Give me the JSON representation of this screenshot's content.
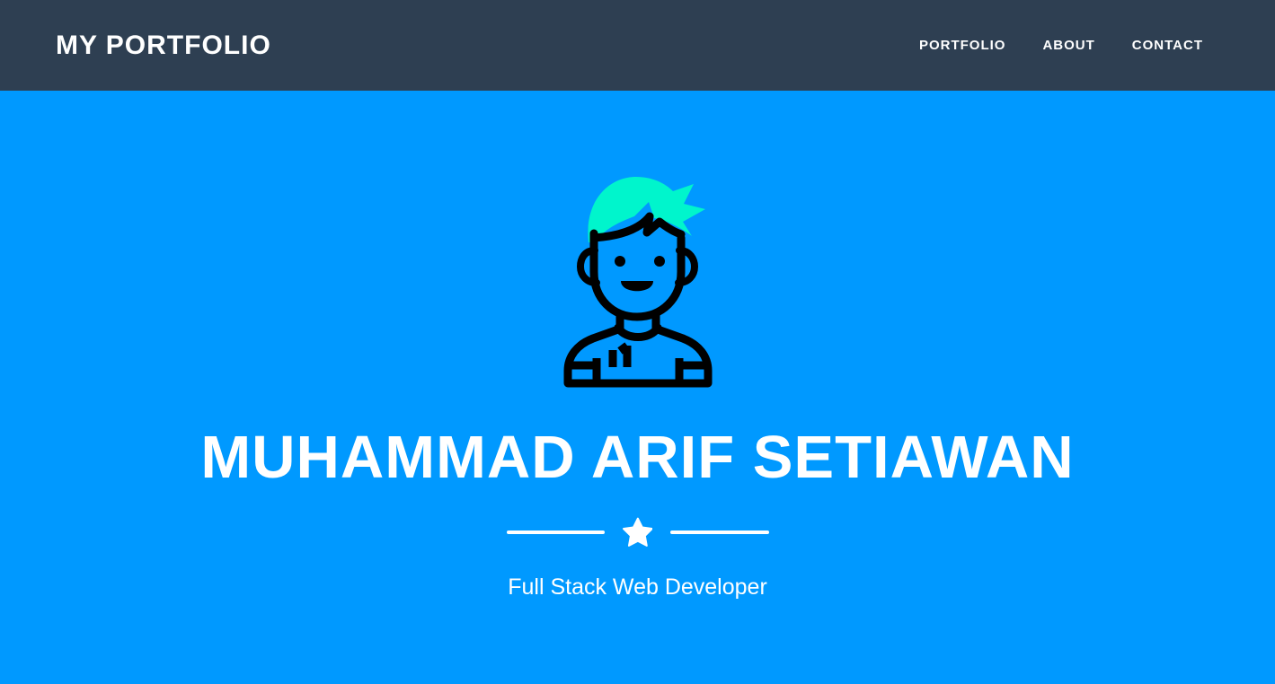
{
  "header": {
    "brand": "MY PORTFOLIO",
    "nav": [
      {
        "label": "PORTFOLIO"
      },
      {
        "label": "ABOUT"
      },
      {
        "label": "CONTACT"
      }
    ],
    "background_color": "#2e3f52",
    "text_color": "#ffffff"
  },
  "hero": {
    "title": "MUHAMMAD ARIF SETIAWAN",
    "subtitle": "Full Stack Web Developer",
    "background_color": "#0099ff",
    "text_color": "#ffffff",
    "avatar": {
      "icon_name": "avatar-illustration",
      "hair_color": "#00f5cc",
      "line_color": "#000000",
      "shirt_number": "11"
    },
    "divider": {
      "icon_name": "star-icon",
      "color": "#ffffff"
    }
  }
}
